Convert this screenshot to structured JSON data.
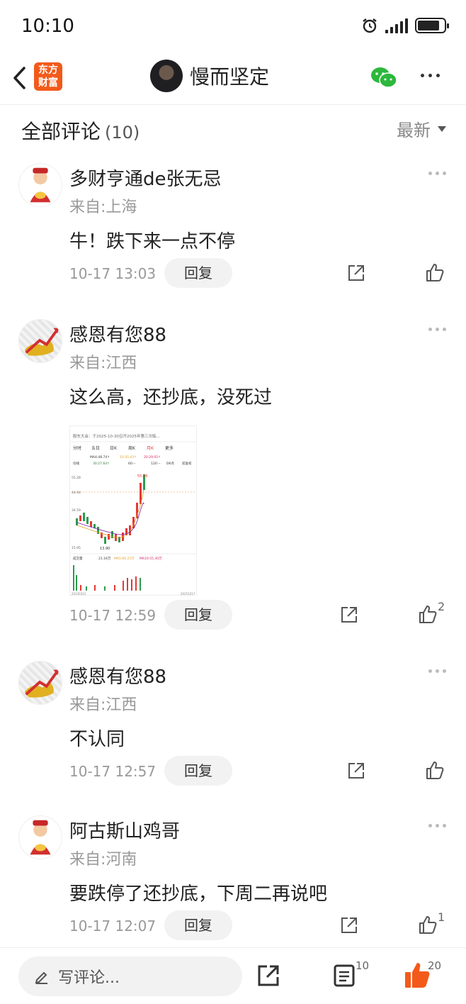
{
  "status_bar": {
    "time": "10:10",
    "battery_percent": 82
  },
  "nav": {
    "logo_text_line1": "东方",
    "logo_text_line2": "财富",
    "author_name": "慢而坚定",
    "accent": "#f35a1a",
    "wechat_color": "#2db83d"
  },
  "section": {
    "title": "全部评论",
    "count": "(10)",
    "sort_label": "最新"
  },
  "comments": [
    {
      "name": "多财亨通de张无忌",
      "location": "来自:上海",
      "text": "牛！跌下来一点不停",
      "time": "10-17 13:03",
      "reply": "回复",
      "likes": "",
      "avatar": "god"
    },
    {
      "name": "感恩有您88",
      "location": "来自:江西",
      "text": "这么高，还抄底，没死过",
      "time": "10-17 12:59",
      "reply": "回复",
      "likes": "2",
      "avatar": "bull",
      "image": {
        "notice": "股东大会：于2025-10-30召开2025年第三次临...",
        "tabs": [
          "分时",
          "五日",
          "日K",
          "周K",
          "月K",
          "更多"
        ],
        "ma_labels": [
          "MA4:48.74↑",
          "10:35.43↑",
          "20:29.05↑"
        ],
        "ma_labels2": [
          "均线",
          "30:27.64↑",
          "60:--",
          "120:--",
          "DK点",
          "前复权"
        ],
        "price_labels": [
          "55.28",
          "44.94",
          "34.59",
          "15.95"
        ],
        "high_label": "55.28",
        "low_label": "13.90",
        "vol_labels": [
          "成交量",
          "21.16万",
          "MA5:60.21万",
          "MA10:55.30万"
        ],
        "date_start": "20230331",
        "date_end": "20251017"
      }
    },
    {
      "name": "感恩有您88",
      "location": "来自:江西",
      "text": "不认同",
      "time": "10-17 12:57",
      "reply": "回复",
      "likes": "",
      "avatar": "bull"
    },
    {
      "name": "阿古斯山鸡哥",
      "location": "来自:河南",
      "text": "要跌停了还抄底，下周二再说吧",
      "time": "10-17 12:07",
      "reply": "回复",
      "likes": "1",
      "avatar": "god"
    }
  ],
  "bottom": {
    "placeholder": "写评论...",
    "comment_count": "10",
    "like_count": "20"
  }
}
